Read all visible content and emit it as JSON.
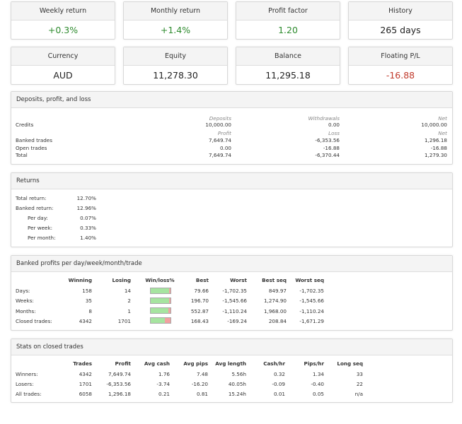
{
  "summary_cards": [
    {
      "label": "Weekly return",
      "value": "+0.3%",
      "tone": "pos"
    },
    {
      "label": "Monthly return",
      "value": "+1.4%",
      "tone": "pos"
    },
    {
      "label": "Profit factor",
      "value": "1.20",
      "tone": "pos"
    },
    {
      "label": "History",
      "value": "265 days",
      "tone": ""
    },
    {
      "label": "Currency",
      "value": "AUD",
      "tone": ""
    },
    {
      "label": "Equity",
      "value": "11,278.30",
      "tone": ""
    },
    {
      "label": "Balance",
      "value": "11,295.18",
      "tone": ""
    },
    {
      "label": "Floating P/L",
      "value": "-16.88",
      "tone": "neg"
    }
  ],
  "deposits": {
    "title": "Deposits, profit, and loss",
    "head1": [
      "Deposits",
      "Withdrawals",
      "Net"
    ],
    "credits": {
      "label": "Credits",
      "values": [
        "10,000.00",
        "0.00",
        "10,000.00"
      ]
    },
    "head2": [
      "Profit",
      "Loss",
      "Net"
    ],
    "rows": [
      {
        "label": "Banked trades",
        "values": [
          "7,649.74",
          "-6,353.56",
          "1,296.18"
        ]
      },
      {
        "label": "Open trades",
        "values": [
          "0.00",
          "-16.88",
          "-16.88"
        ]
      },
      {
        "label": "Total",
        "values": [
          "7,649.74",
          "-6,370.44",
          "1,279.30"
        ]
      }
    ]
  },
  "returns": {
    "title": "Returns",
    "rows": [
      {
        "label": "Total return:",
        "value": "12.70%"
      },
      {
        "label": "Banked return:",
        "value": "12.96%"
      },
      {
        "label": "Per day:",
        "value": "0.07%"
      },
      {
        "label": "Per week:",
        "value": "0.33%"
      },
      {
        "label": "Per month:",
        "value": "1.40%"
      }
    ]
  },
  "banked": {
    "title": "Banked profits per day/week/month/trade",
    "columns": [
      "Winning",
      "Losing",
      "Win/loss%",
      "Best",
      "Worst",
      "Best seq",
      "Worst seq"
    ],
    "rows": [
      {
        "label": "Days:",
        "winning": "158",
        "losing": "14",
        "win_fraction": 0.9186,
        "best": "79.66",
        "worst": "-1,702.35",
        "best_seq": "849.97",
        "worst_seq": "-1,702.35"
      },
      {
        "label": "Weeks:",
        "winning": "35",
        "losing": "2",
        "win_fraction": 0.9459,
        "best": "196.70",
        "worst": "-1,545.66",
        "best_seq": "1,274.90",
        "worst_seq": "-1,545.66"
      },
      {
        "label": "Months:",
        "winning": "8",
        "losing": "1",
        "win_fraction": 0.8889,
        "best": "552.87",
        "worst": "-1,110.24",
        "best_seq": "1,968.00",
        "worst_seq": "-1,110.24"
      },
      {
        "label": "Closed trades:",
        "winning": "4342",
        "losing": "1701",
        "win_fraction": 0.7185,
        "best": "168.43",
        "worst": "-169.24",
        "best_seq": "208.84",
        "worst_seq": "-1,671.29"
      }
    ]
  },
  "closed": {
    "title": "Stats on closed trades",
    "columns": [
      "Trades",
      "Profit",
      "Avg cash",
      "Avg pips",
      "Avg length",
      "Cash/hr",
      "Pips/hr",
      "Long seq"
    ],
    "rows": [
      {
        "label": "Winners:",
        "values": [
          "4342",
          "7,649.74",
          "1.76",
          "7.48",
          "5.56h",
          "0.32",
          "1.34",
          "33"
        ]
      },
      {
        "label": "Losers:",
        "values": [
          "1701",
          "-6,353.56",
          "-3.74",
          "-16.20",
          "40.05h",
          "-0.09",
          "-0.40",
          "22"
        ]
      },
      {
        "label": "All trades:",
        "values": [
          "6058",
          "1,296.18",
          "0.21",
          "0.81",
          "15.24h",
          "0.01",
          "0.05",
          "n/a"
        ]
      }
    ]
  }
}
